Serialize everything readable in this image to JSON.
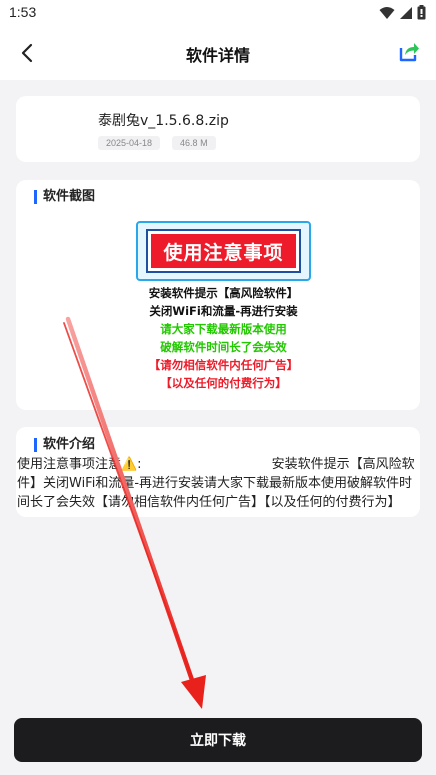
{
  "status_bar": {
    "time": "1:53"
  },
  "header": {
    "title": "软件详情"
  },
  "file": {
    "name": "泰剧兔v_1.5.6.8.zip",
    "date": "2025-04-18",
    "size": "46.8 M"
  },
  "screenshot_section": {
    "title": "软件截图",
    "image": {
      "banner_text": "使用注意事项",
      "lines": [
        {
          "text": "安装软件提示【高风险软件】",
          "color": "#111111"
        },
        {
          "text": "关闭WiFi和流量-再进行安装",
          "color": "#111111"
        },
        {
          "text": "请大家下载最新版本使用",
          "color": "#22c800"
        },
        {
          "text": "破解软件时间长了会失效",
          "color": "#22c800"
        },
        {
          "text": "【请勿相信软件内任何广告】",
          "color": "#ee1c2a"
        },
        {
          "text": "【以及任何的付费行为】",
          "color": "#ee1c2a"
        }
      ]
    }
  },
  "intro_section": {
    "title": "软件介绍",
    "text": "使用注意事项注意⚠️:　　　　　　　　　　安装软件提示【高风险软件】关闭WiFi和流量-再进行安装请大家下载最新版本使用破解软件时间长了会失效【请勿相信软件内任何广告】【以及任何的付费行为】"
  },
  "download_button": {
    "label": "立即下载"
  },
  "colors": {
    "accent": "#1f66ff",
    "arrow": "#e8211c",
    "button": "#1c1c1e"
  }
}
